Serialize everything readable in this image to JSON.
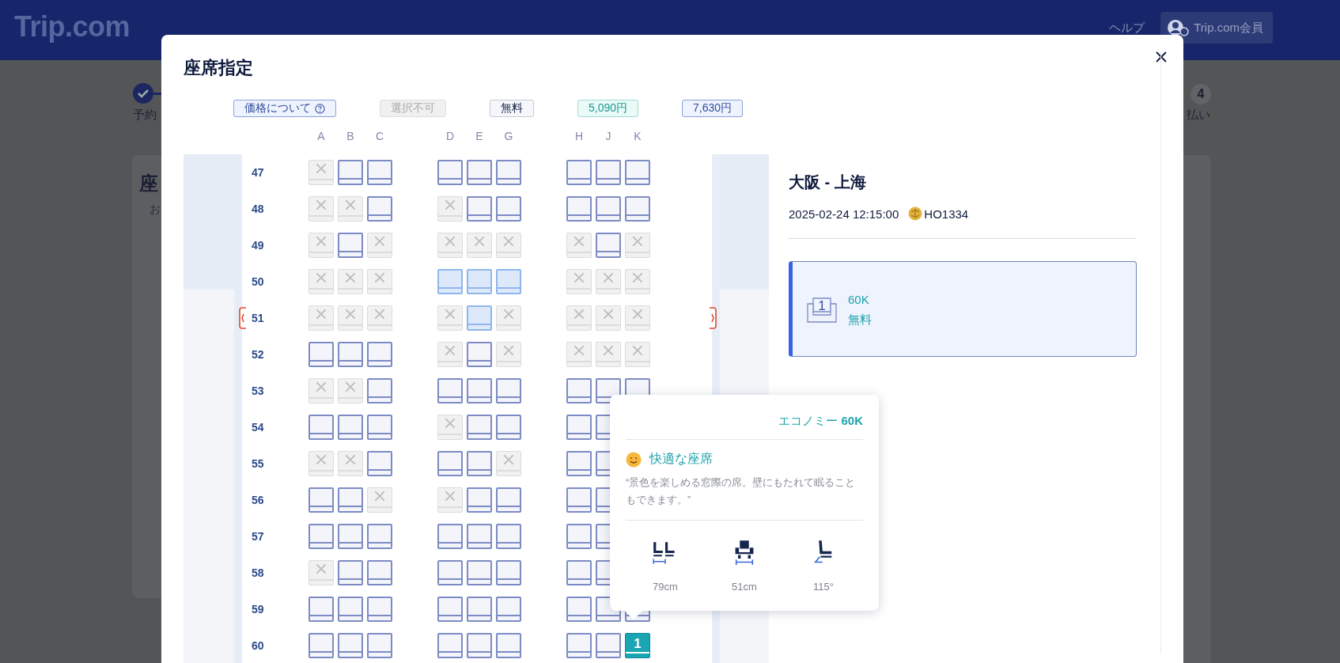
{
  "header": {
    "logo": "Trip.com",
    "help": "ヘルプ",
    "member": "Trip.com会員"
  },
  "background": {
    "left_step_label": "予約",
    "left_card_heading": "座",
    "left_card_text": "お",
    "right_step_number": "4",
    "right_step_label": "払い"
  },
  "modal": {
    "title": "座席指定",
    "legend": [
      {
        "kind": "info",
        "label": "価格について"
      },
      {
        "kind": "unavailable",
        "label": "選択不可"
      },
      {
        "kind": "free",
        "label": "無料"
      },
      {
        "kind": "price-low",
        "label": "5,090円"
      },
      {
        "kind": "price-high",
        "label": "7,630円"
      }
    ],
    "columns": [
      "A",
      "B",
      "C",
      "D",
      "E",
      "G",
      "H",
      "J",
      "K"
    ],
    "rows": [
      {
        "number": "47",
        "exit": false,
        "seats": [
          {
            "kind": "taken"
          },
          {
            "kind": "open"
          },
          {
            "kind": "open"
          },
          {
            "kind": "open"
          },
          {
            "kind": "open"
          },
          {
            "kind": "open"
          },
          {
            "kind": "open"
          },
          {
            "kind": "open"
          },
          {
            "kind": "open"
          }
        ]
      },
      {
        "number": "48",
        "exit": false,
        "seats": [
          {
            "kind": "taken"
          },
          {
            "kind": "taken"
          },
          {
            "kind": "open"
          },
          {
            "kind": "taken"
          },
          {
            "kind": "open"
          },
          {
            "kind": "open"
          },
          {
            "kind": "open"
          },
          {
            "kind": "open"
          },
          {
            "kind": "open"
          }
        ]
      },
      {
        "number": "49",
        "exit": false,
        "seats": [
          {
            "kind": "taken"
          },
          {
            "kind": "open"
          },
          {
            "kind": "taken"
          },
          {
            "kind": "taken"
          },
          {
            "kind": "taken"
          },
          {
            "kind": "taken"
          },
          {
            "kind": "taken"
          },
          {
            "kind": "open"
          },
          {
            "kind": "taken"
          }
        ]
      },
      {
        "number": "50",
        "exit": false,
        "seats": [
          {
            "kind": "taken"
          },
          {
            "kind": "taken"
          },
          {
            "kind": "taken"
          },
          {
            "kind": "free"
          },
          {
            "kind": "free"
          },
          {
            "kind": "free"
          },
          {
            "kind": "taken"
          },
          {
            "kind": "taken"
          },
          {
            "kind": "taken"
          }
        ]
      },
      {
        "number": "51",
        "exit": true,
        "seats": [
          {
            "kind": "taken"
          },
          {
            "kind": "taken"
          },
          {
            "kind": "taken"
          },
          {
            "kind": "taken"
          },
          {
            "kind": "free"
          },
          {
            "kind": "taken"
          },
          {
            "kind": "taken"
          },
          {
            "kind": "taken"
          },
          {
            "kind": "taken"
          }
        ]
      },
      {
        "number": "52",
        "exit": false,
        "seats": [
          {
            "kind": "open"
          },
          {
            "kind": "open"
          },
          {
            "kind": "open"
          },
          {
            "kind": "taken"
          },
          {
            "kind": "open"
          },
          {
            "kind": "taken"
          },
          {
            "kind": "taken"
          },
          {
            "kind": "taken"
          },
          {
            "kind": "taken"
          }
        ]
      },
      {
        "number": "53",
        "exit": false,
        "seats": [
          {
            "kind": "taken"
          },
          {
            "kind": "taken"
          },
          {
            "kind": "open"
          },
          {
            "kind": "open"
          },
          {
            "kind": "open"
          },
          {
            "kind": "open"
          },
          {
            "kind": "open"
          },
          {
            "kind": "open"
          },
          {
            "kind": "open"
          }
        ]
      },
      {
        "number": "54",
        "exit": false,
        "seats": [
          {
            "kind": "open"
          },
          {
            "kind": "open"
          },
          {
            "kind": "open"
          },
          {
            "kind": "taken"
          },
          {
            "kind": "open"
          },
          {
            "kind": "open"
          },
          {
            "kind": "open"
          },
          {
            "kind": "open"
          }
        ]
      },
      {
        "number": "55",
        "exit": false,
        "seats": [
          {
            "kind": "taken"
          },
          {
            "kind": "taken"
          },
          {
            "kind": "open"
          },
          {
            "kind": "open"
          },
          {
            "kind": "open"
          },
          {
            "kind": "taken"
          },
          {
            "kind": "open"
          },
          {
            "kind": "open"
          }
        ]
      },
      {
        "number": "56",
        "exit": false,
        "seats": [
          {
            "kind": "open"
          },
          {
            "kind": "open"
          },
          {
            "kind": "taken"
          },
          {
            "kind": "taken"
          },
          {
            "kind": "open"
          },
          {
            "kind": "open"
          },
          {
            "kind": "open"
          },
          {
            "kind": "open"
          }
        ]
      },
      {
        "number": "57",
        "exit": false,
        "seats": [
          {
            "kind": "open"
          },
          {
            "kind": "open"
          },
          {
            "kind": "open"
          },
          {
            "kind": "open"
          },
          {
            "kind": "open"
          },
          {
            "kind": "open"
          },
          {
            "kind": "open"
          },
          {
            "kind": "open"
          }
        ]
      },
      {
        "number": "58",
        "exit": false,
        "seats": [
          {
            "kind": "taken"
          },
          {
            "kind": "open"
          },
          {
            "kind": "open"
          },
          {
            "kind": "open"
          },
          {
            "kind": "open"
          },
          {
            "kind": "open"
          },
          {
            "kind": "open"
          },
          {
            "kind": "open"
          }
        ]
      },
      {
        "number": "59",
        "exit": false,
        "seats": [
          {
            "kind": "open"
          },
          {
            "kind": "open"
          },
          {
            "kind": "open"
          },
          {
            "kind": "open"
          },
          {
            "kind": "open"
          },
          {
            "kind": "open"
          },
          {
            "kind": "open"
          },
          {
            "kind": "open"
          },
          {
            "kind": "open"
          }
        ]
      },
      {
        "number": "60",
        "exit": false,
        "seats": [
          {
            "kind": "open"
          },
          {
            "kind": "open"
          },
          {
            "kind": "open"
          },
          {
            "kind": "open"
          },
          {
            "kind": "open"
          },
          {
            "kind": "open"
          },
          {
            "kind": "open"
          },
          {
            "kind": "open"
          },
          {
            "kind": "chosen",
            "label": "1"
          }
        ]
      }
    ],
    "flight": {
      "route": "大阪 - 上海",
      "datetime": "2025-02-24 12:15:00",
      "flight_number": "HO1334"
    },
    "passenger": {
      "selected": true,
      "seat_label": "1",
      "seat": "60K",
      "price": "無料"
    },
    "tooltip": {
      "heading": "エコノミー **60K**",
      "feature": "快適な座席",
      "quote": "“景色を楽しめる窓際の席。壁にもたれて眠ることもできます。”",
      "specs": [
        {
          "kind": "pitch",
          "value": "79cm"
        },
        {
          "kind": "width",
          "value": "51cm"
        },
        {
          "kind": "recline",
          "value": "115°"
        }
      ]
    }
  }
}
